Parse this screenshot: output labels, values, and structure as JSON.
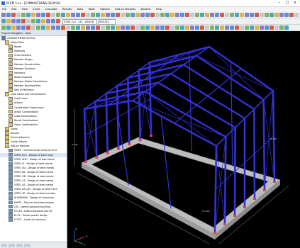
{
  "window": {
    "title": "RFEM 5.xx - [GYMNASTHENS DEOFSA]",
    "app_icon": "rfem-app-icon",
    "controls": [
      "minimize-icon",
      "maximize-icon",
      "close-icon"
    ]
  },
  "menu": [
    "File",
    "Edit",
    "View",
    "Insert",
    "Calculate",
    "Results",
    "Tools",
    "Table",
    "Options",
    "Add-on Modules",
    "Window",
    "Help"
  ],
  "toolbar": {
    "load_case_combo": "STEEL EC3 - CA1 - DESIGN",
    "status_combo": "RESULTS"
  },
  "navigator": {
    "title": "Project Navigator - Data",
    "project": "GYMNASTHENS DEOFSA",
    "tree": [
      {
        "label": "GYMNASTHENS DEOFSA",
        "level": 0,
        "color": "#4a7fc1"
      },
      {
        "label": "Model Data",
        "level": 1,
        "color": "#e9c55d"
      },
      {
        "label": "Nodes",
        "level": 2,
        "color": "#e9c55d"
      },
      {
        "label": "Materials",
        "level": 2,
        "color": "#e9c55d"
      },
      {
        "label": "Cross-Sections",
        "level": 2,
        "color": "#e9c55d"
      },
      {
        "label": "Member Hinges",
        "level": 2,
        "color": "#e9c55d"
      },
      {
        "label": "Member Eccentricities",
        "level": 2,
        "color": "#e9c55d"
      },
      {
        "label": "Member Divisions",
        "level": 2,
        "color": "#e9c55d"
      },
      {
        "label": "Members",
        "level": 2,
        "color": "#e9c55d"
      },
      {
        "label": "Nodal Supports",
        "level": 2,
        "color": "#e9c55d"
      },
      {
        "label": "Member Elastic Foundations",
        "level": 2,
        "color": "#e9c55d"
      },
      {
        "label": "Member Nonlinearities",
        "level": 2,
        "color": "#e9c55d"
      },
      {
        "label": "Sets of Members",
        "level": 2,
        "color": "#e9c55d"
      },
      {
        "label": "Load Cases and Combinations",
        "level": 1,
        "color": "#e9c55d"
      },
      {
        "label": "Load Cases",
        "level": 2,
        "color": "#e9c55d"
      },
      {
        "label": "Actions",
        "level": 2,
        "color": "#e9c55d"
      },
      {
        "label": "Combination Expressions",
        "level": 2,
        "color": "#e9c55d"
      },
      {
        "label": "Action Combinations",
        "level": 2,
        "color": "#e9c55d"
      },
      {
        "label": "Load Combinations",
        "level": 2,
        "color": "#e9c55d"
      },
      {
        "label": "Result Combinations",
        "level": 2,
        "color": "#e9c55d"
      },
      {
        "label": "Super Combinations",
        "level": 2,
        "color": "#e9c55d"
      },
      {
        "label": "Loads",
        "level": 1,
        "color": "#e9c55d"
      },
      {
        "label": "Results",
        "level": 1,
        "color": "#e9c55d"
      },
      {
        "label": "Printout Reports",
        "level": 1,
        "color": "#e9c55d"
      },
      {
        "label": "Guide Objects",
        "level": 1,
        "color": "#e9c55d"
      },
      {
        "label": "Add-on Modules",
        "level": 1,
        "color": "#e9c55d"
      },
      {
        "label": "STEEL - General stress analysis of st",
        "level": 2,
        "color": "#5aa0d8"
      },
      {
        "label": "STEEL EC3 - Design of steel mem",
        "level": 2,
        "color": "#5aa0d8",
        "selected": true
      },
      {
        "label": "STEEL AISC - Design of steel meml",
        "level": 2,
        "color": "#5aa0d8"
      },
      {
        "label": "STEEL IS - Design of steel memb",
        "level": 2,
        "color": "#5aa0d8"
      },
      {
        "label": "STEEL SIA - Design of steel memb",
        "level": 2,
        "color": "#5aa0d8"
      },
      {
        "label": "STEEL BS - Design of steel memb",
        "level": 2,
        "color": "#5aa0d8"
      },
      {
        "label": "STEEL GB - Design of steel memb",
        "level": 2,
        "color": "#5aa0d8"
      },
      {
        "label": "STEEL CS - Design of steel memb",
        "level": 2,
        "color": "#5aa0d8"
      },
      {
        "label": "STEEL AS - Design of steel memb",
        "level": 2,
        "color": "#5aa0d8"
      },
      {
        "label": "STEEL NTC-DF - Design of steel mem",
        "level": 2,
        "color": "#5aa0d8"
      },
      {
        "label": "STEEL SP - Design of steel member",
        "level": 2,
        "color": "#5aa0d8"
      },
      {
        "label": "ALUMINIUM - Design of aluminium",
        "level": 2,
        "color": "#5aa0d8"
      },
      {
        "label": "KAPPA - Flexural buckling analysis",
        "level": 2,
        "color": "#5aa0d8"
      },
      {
        "label": "LTB - Lateral-torsional buckling",
        "level": 2,
        "color": "#5aa0d8"
      },
      {
        "label": "FE-LTB - Lateral-torsional and fle",
        "level": 2,
        "color": "#5aa0d8"
      },
      {
        "label": "EL-PL - Elastic-plastic design",
        "level": 2,
        "color": "#5aa0d8"
      },
      {
        "label": "C-TO-T - Limit (c/t) analysis",
        "level": 2,
        "color": "#5aa0d8"
      }
    ]
  },
  "view": {
    "background": "#000000",
    "member_color": "#3232d8",
    "foundation_color": "#bdbdbd",
    "support_color": "#e0423c",
    "dim_labels": [
      "32.000",
      "15.000",
      "8.000"
    ],
    "axis_labels": [
      "X",
      "Y",
      "Z"
    ]
  }
}
